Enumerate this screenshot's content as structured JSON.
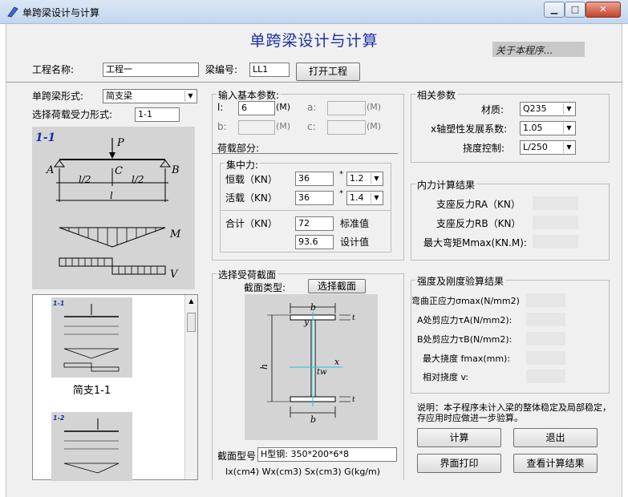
{
  "window": {
    "title": "单跨梁设计与计算"
  },
  "header": {
    "app_title": "单跨梁设计与计算",
    "about": "关于本程序..."
  },
  "project": {
    "name_label": "工程名称:",
    "name_value": "工程一",
    "beam_no_label": "梁编号:",
    "beam_no_value": "LL1",
    "open_button": "打开工程"
  },
  "beam": {
    "type_label": "单跨梁形式:",
    "type_value": "简支梁",
    "load_label": "选择荷载受力形式:",
    "load_value": "1-1",
    "diagram": {
      "case": "1-1",
      "P": "P",
      "A": "A",
      "B": "B",
      "C": "C",
      "half1": "l/2",
      "half2": "l/2",
      "span": "l",
      "M": "M",
      "V": "V"
    },
    "list": [
      {
        "case": "1-1",
        "caption": "简支1-1"
      },
      {
        "case": "1-2",
        "caption": ""
      }
    ]
  },
  "basic": {
    "group_title": "输入基本参数:",
    "l_label": "l:",
    "l_value": "6",
    "l_unit": "(M)",
    "a_label": "a:",
    "a_unit": "(M)",
    "b_label": "b:",
    "b_unit": "(M)",
    "c_label": "c:",
    "c_unit": "(M)",
    "load_section": "荷载部分:",
    "concentrated": "集中力:",
    "dead_label": "恒载（KN）",
    "dead_value": "36",
    "dead_factor": "1.2",
    "live_label": "活载（KN）",
    "live_value": "36",
    "live_factor": "1.4",
    "total_label": "合计（KN）",
    "std_value": "72",
    "std_label": "标准值",
    "design_value": "93.6",
    "design_label": "设计值",
    "times": "*"
  },
  "params": {
    "group_title": "相关参数",
    "material_label": "材质:",
    "material_value": "Q235",
    "plastic_label": "x轴塑性发展系数:",
    "plastic_value": "1.05",
    "deflection_label": "挠度控制:",
    "deflection_value": "L/250"
  },
  "internal": {
    "group_title": "内力计算结果",
    "ra_label": "支座反力RA（KN）",
    "rb_label": "支座反力RB（KN）",
    "mmax_label": "最大弯矩Mmax(KN.M):"
  },
  "section": {
    "group_title": "选择受荷截面",
    "type_label": "截面类型:",
    "select_button": "选择截面",
    "model_label": "截面型号",
    "model_value": "H型钢: 350*200*6*8",
    "props": "Ix(cm4)  Wx(cm3)  Sx(cm3)  G(kg/m)",
    "dims": {
      "b_top": "b",
      "b_bottom": "b",
      "y": "y",
      "x": "x",
      "h": "h",
      "tw": "tw",
      "t1": "t",
      "t2": "t"
    }
  },
  "strength": {
    "group_title": "强度及刚度验算结果",
    "sigma_label": "弯曲正应力σmax(N/mm2)",
    "tau_a_label": "A处剪应力τA(N/mm2):",
    "tau_b_label": "B处剪应力τB(N/mm2):",
    "fmax_label": "最大挠度  fmax(mm):",
    "rel_label": "相对挠度      v:"
  },
  "note": "说明：本子程序未计入梁的整体稳定及局部稳定，存应用时应做进一步验算。",
  "actions": {
    "calc": "计算",
    "exit": "退出",
    "print": "界面打印",
    "view": "查看计算结果"
  }
}
